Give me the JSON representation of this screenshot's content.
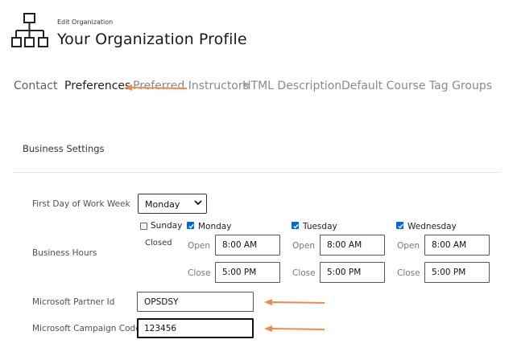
{
  "header": {
    "eyebrow": "Edit Organization",
    "title": "Your Organization Profile"
  },
  "tabs": [
    {
      "label": "Contact",
      "active": false
    },
    {
      "label": "Preferences",
      "active": true
    },
    {
      "label": "Preferred Instructors",
      "active": false
    },
    {
      "label": "HTML Description",
      "active": false
    },
    {
      "label": "Default Course Tag Groups",
      "active": false
    }
  ],
  "section": {
    "title": "Business Settings"
  },
  "form": {
    "first_day_label": "First Day of Work Week",
    "first_day_value": "Monday",
    "business_hours_label": "Business Hours",
    "open_label": "Open",
    "close_label": "Close",
    "closed_text": "Closed",
    "days": [
      {
        "name": "Sunday",
        "checked": false
      },
      {
        "name": "Monday",
        "checked": true,
        "open": "8:00 AM",
        "close": "5:00 PM"
      },
      {
        "name": "Tuesday",
        "checked": true,
        "open": "8:00 AM",
        "close": "5:00 PM"
      },
      {
        "name": "Wednesday",
        "checked": true,
        "open": "8:00 AM",
        "close": "5:00 PM"
      }
    ],
    "partner_id_label": "Microsoft Partner Id",
    "partner_id_value": "OPSDSY",
    "campaign_code_label": "Microsoft Campaign Code",
    "campaign_code_value": "123456"
  },
  "colors": {
    "accent": "#0a66d0",
    "annotation_arrow": "#f08a4b"
  },
  "icons": {
    "org": "org-chart-icon",
    "select_caret": "chevron-down-icon",
    "check": "checkmark-icon"
  }
}
